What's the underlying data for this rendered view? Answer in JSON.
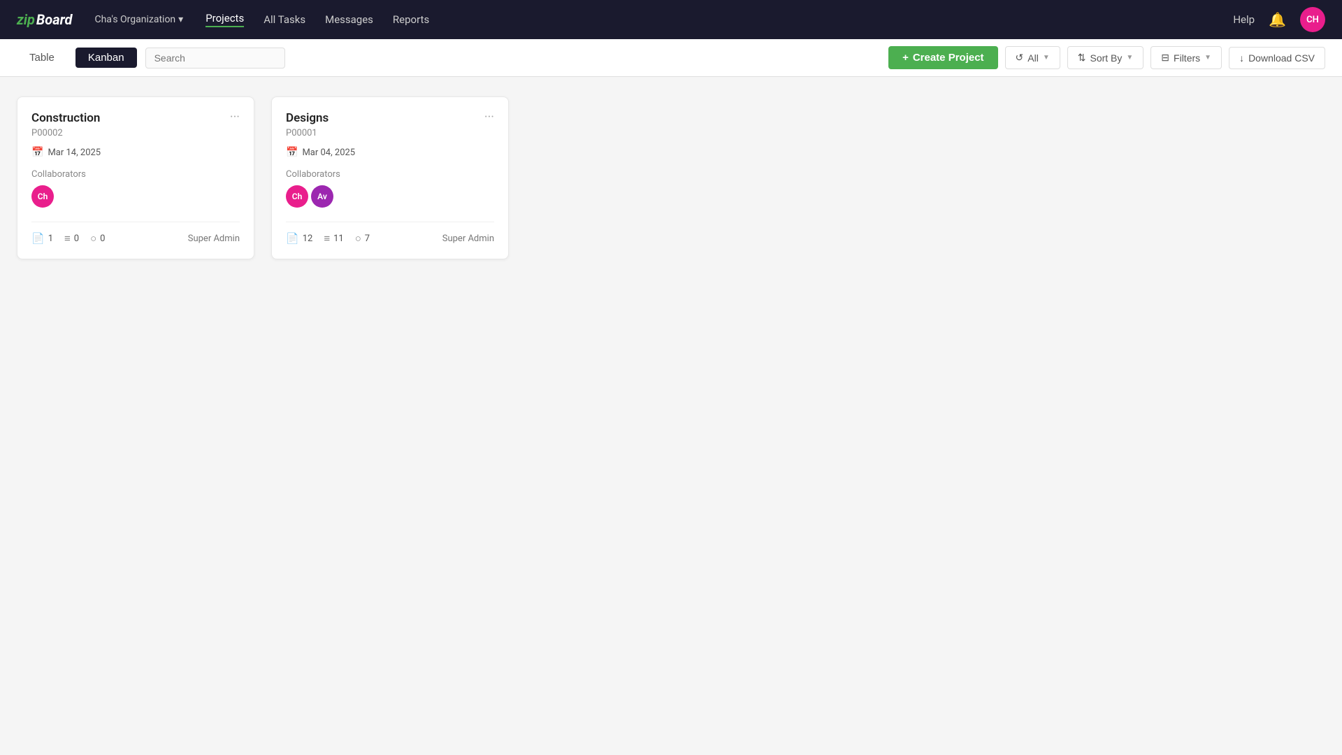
{
  "brand": {
    "logo_zip": "zip",
    "logo_board": "Board"
  },
  "navbar": {
    "org_name": "Cha's Organization",
    "chevron": "▾",
    "links": [
      {
        "label": "Projects",
        "active": true
      },
      {
        "label": "All Tasks",
        "active": false
      },
      {
        "label": "Messages",
        "active": false
      },
      {
        "label": "Reports",
        "active": false
      }
    ],
    "help": "Help",
    "user_initials": "CH"
  },
  "toolbar": {
    "view_table": "Table",
    "view_kanban": "Kanban",
    "search_placeholder": "Search",
    "create_project_icon": "+",
    "create_project_label": "Create Project",
    "all_label": "All",
    "sort_by_label": "Sort By",
    "filters_label": "Filters",
    "download_csv_label": "Download CSV"
  },
  "projects": [
    {
      "title": "Construction",
      "id": "P00002",
      "date": "Mar 14, 2025",
      "collaborators_label": "Collaborators",
      "collaborators": [
        {
          "initials": "Ch",
          "color": "#e91e8c"
        }
      ],
      "stats": [
        {
          "icon": "📄",
          "value": "1"
        },
        {
          "icon": "≡",
          "value": "0"
        },
        {
          "icon": "○",
          "value": "0"
        }
      ],
      "role": "Super Admin"
    },
    {
      "title": "Designs",
      "id": "P00001",
      "date": "Mar 04, 2025",
      "collaborators_label": "Collaborators",
      "collaborators": [
        {
          "initials": "Ch",
          "color": "#e91e8c"
        },
        {
          "initials": "Av",
          "color": "#9c27b0"
        }
      ],
      "stats": [
        {
          "icon": "📄",
          "value": "12"
        },
        {
          "icon": "≡",
          "value": "11"
        },
        {
          "icon": "○",
          "value": "7"
        }
      ],
      "role": "Super Admin"
    }
  ]
}
